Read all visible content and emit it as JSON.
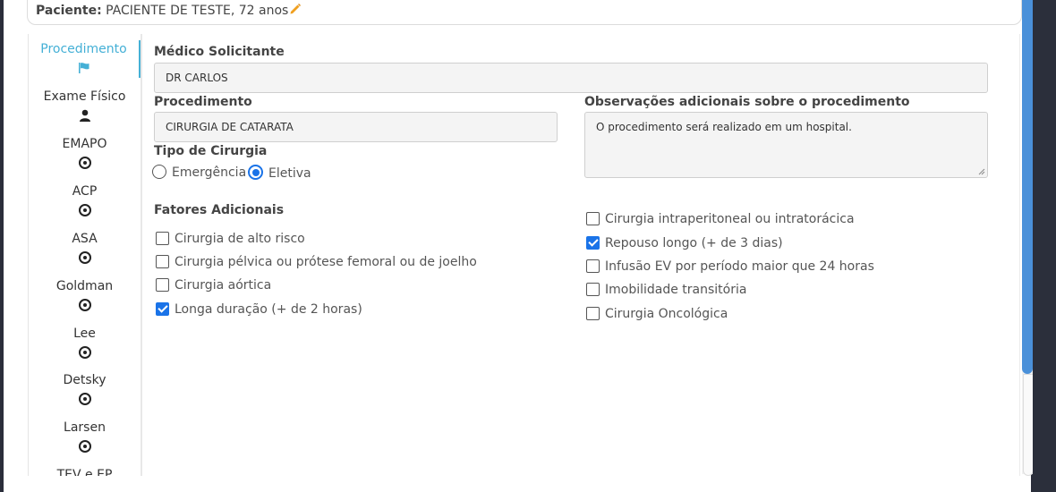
{
  "patient": {
    "label": "Paciente:",
    "value": "PACIENTE DE TESTE, 72 anos"
  },
  "sidebar": {
    "items": [
      {
        "label": "Procedimento",
        "icon": "flag-icon",
        "active": true
      },
      {
        "label": "Exame Físico",
        "icon": "user-icon"
      },
      {
        "label": "EMAPO",
        "icon": "radio-icon"
      },
      {
        "label": "ACP",
        "icon": "radio-icon"
      },
      {
        "label": "ASA",
        "icon": "radio-icon"
      },
      {
        "label": "Goldman",
        "icon": "radio-icon"
      },
      {
        "label": "Lee",
        "icon": "radio-icon"
      },
      {
        "label": "Detsky",
        "icon": "radio-icon"
      },
      {
        "label": "Larsen",
        "icon": "radio-icon"
      },
      {
        "label": "TEV e EP"
      }
    ]
  },
  "form": {
    "medico_label": "Médico Solicitante",
    "medico_value": "DR CARLOS",
    "procedimento_label": "Procedimento",
    "procedimento_value": "CIRURGIA DE CATARATA",
    "observacoes_label": "Observações adicionais sobre o procedimento",
    "observacoes_value": "O procedimento será realizado em um hospital.",
    "tipo_label": "Tipo de Cirurgia",
    "tipo_options": [
      {
        "label": "Emergência",
        "selected": false
      },
      {
        "label": "Eletiva",
        "selected": true
      }
    ],
    "fatores_label": "Fatores Adicionais",
    "fatores_left": [
      {
        "label": "Cirurgia de alto risco",
        "checked": false
      },
      {
        "label": "Cirurgia pélvica ou prótese femoral ou de joelho",
        "checked": false
      },
      {
        "label": "Cirurgia aórtica",
        "checked": false
      },
      {
        "label": "Longa duração (+ de 2 horas)",
        "checked": true
      }
    ],
    "fatores_right": [
      {
        "label": "Cirurgia intraperitoneal ou intratorácica",
        "checked": false
      },
      {
        "label": "Repouso longo (+ de 3 dias)",
        "checked": true
      },
      {
        "label": "Infusão EV por período maior que 24 horas",
        "checked": false
      },
      {
        "label": "Imobilidade transitória",
        "checked": false
      },
      {
        "label": "Cirurgia Oncológica",
        "checked": false
      }
    ]
  },
  "colors": {
    "accent": "#45b0d6",
    "checkbox": "#1a73e8",
    "scrollbar": "#4a90d9"
  }
}
